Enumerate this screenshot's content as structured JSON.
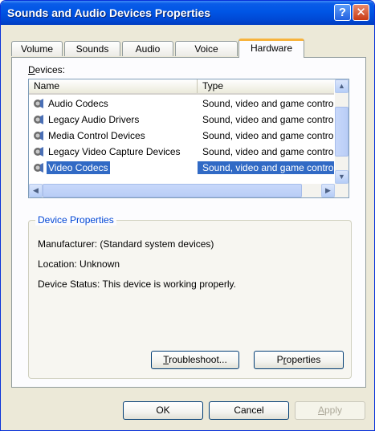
{
  "window": {
    "title": "Sounds and Audio Devices Properties",
    "help_glyph": "?",
    "close_glyph": "✕"
  },
  "tabs": [
    {
      "label": "Volume"
    },
    {
      "label": "Sounds"
    },
    {
      "label": "Audio"
    },
    {
      "label": "Voice"
    },
    {
      "label": "Hardware",
      "active": true
    }
  ],
  "devices": {
    "label_accel": "D",
    "label_rest": "evices:",
    "columns": {
      "name": "Name",
      "type": "Type"
    },
    "rows": [
      {
        "name": "Audio Codecs",
        "type": "Sound, video and game controllers"
      },
      {
        "name": "Legacy Audio Drivers",
        "type": "Sound, video and game controllers"
      },
      {
        "name": "Media Control Devices",
        "type": "Sound, video and game controllers"
      },
      {
        "name": "Legacy Video Capture Devices",
        "type": "Sound, video and game controllers"
      },
      {
        "name": "Video Codecs",
        "type": "Sound, video and game controllers",
        "selected": true
      }
    ]
  },
  "device_properties": {
    "title": "Device Properties",
    "manufacturer": "Manufacturer: (Standard system devices)",
    "location": "Location: Unknown",
    "status": "Device Status: This device is working properly.",
    "troubleshoot_accel": "T",
    "troubleshoot_rest": "roubleshoot...",
    "properties_pre": "P",
    "properties_accel": "r",
    "properties_rest": "operties"
  },
  "footer": {
    "ok": "OK",
    "cancel": "Cancel",
    "apply_accel": "A",
    "apply_rest": "pply"
  },
  "colors": {
    "titlebar": "#0055e5",
    "selection": "#316ac5",
    "group_title": "#0046d5",
    "active_tab_accent": "#f7b33d"
  },
  "icons": {
    "device": "speaker-gear-icon",
    "scroll_up": "▲",
    "scroll_down": "▼",
    "scroll_left": "◀",
    "scroll_right": "▶"
  }
}
